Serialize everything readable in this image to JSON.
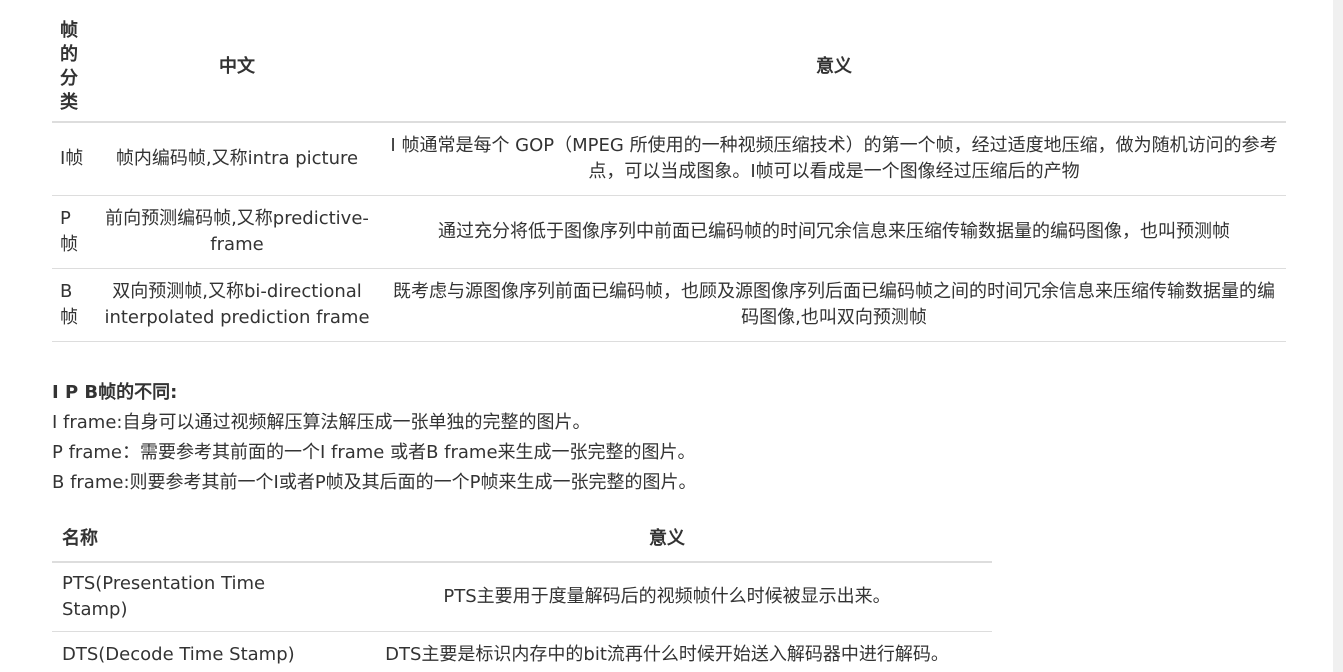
{
  "frame_table": {
    "headers": {
      "col1_chars": [
        "帧",
        "的",
        "分",
        "类"
      ],
      "col2": "中文",
      "col3": "意义"
    },
    "rows": [
      {
        "type": "I帧",
        "chinese": "帧内编码帧,又称intra picture",
        "meaning": "I 帧通常是每个 GOP（MPEG 所使用的一种视频压缩技术）的第一个帧，经过适度地压缩，做为随机访问的参考点，可以当成图象。I帧可以看成是一个图像经过压缩后的产物"
      },
      {
        "type": "P帧",
        "chinese": "前向预测编码帧,又称predictive-frame",
        "meaning": "通过充分将低于图像序列中前面已编码帧的时间冗余信息来压缩传输数据量的编码图像，也叫预测帧"
      },
      {
        "type": "B帧",
        "chinese": "双向预测帧,又称bi-directional interpolated prediction frame",
        "meaning": "既考虑与源图像序列前面已编码帧，也顾及源图像序列后面已编码帧之间的时间冗余信息来压缩传输数据量的编码图像,也叫双向预测帧"
      }
    ]
  },
  "ipb_section": {
    "heading": "I P B帧的不同:",
    "lines": [
      "I frame:自身可以通过视频解压算法解压成一张单独的完整的图片。",
      "P frame：需要参考其前面的一个I frame 或者B frame来生成一张完整的图片。",
      "B frame:则要参考其前一个I或者P帧及其后面的一个P帧来生成一张完整的图片。"
    ]
  },
  "ts_table": {
    "headers": {
      "name": "名称",
      "meaning": "意义"
    },
    "rows": [
      {
        "name": "PTS(Presentation Time Stamp)",
        "meaning": "PTS主要用于度量解码后的视频帧什么时候被显示出来。"
      },
      {
        "name": "DTS(Decode Time Stamp)",
        "meaning": "DTS主要是标识内存中的bit流再什么时候开始送入解码器中进行解码。"
      }
    ]
  }
}
